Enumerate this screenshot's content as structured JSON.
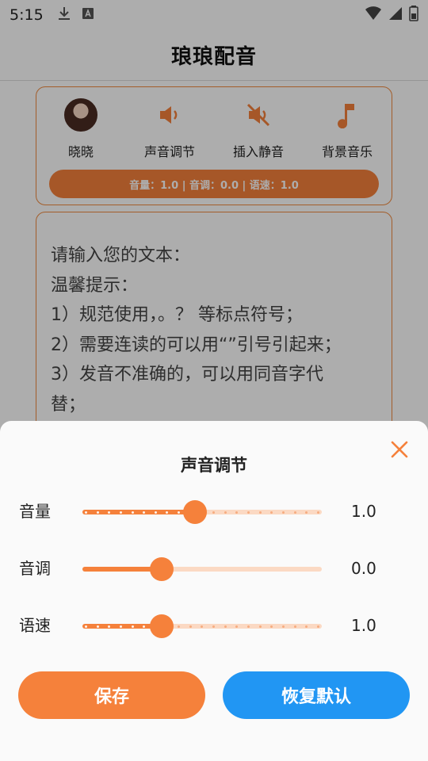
{
  "status_bar": {
    "time": "5:15"
  },
  "app": {
    "title": "琅琅配音"
  },
  "toolbar": {
    "items": [
      {
        "label": "晓晓",
        "icon": "avatar"
      },
      {
        "label": "声音调节",
        "icon": "volume-icon"
      },
      {
        "label": "插入静音",
        "icon": "mute-icon"
      },
      {
        "label": "背景音乐",
        "icon": "music-note-icon"
      }
    ],
    "params_text": "音量：1.0 | 音调：0.0 | 语速：1.0"
  },
  "editor": {
    "lines": [
      "请输入您的文本：",
      "温馨提示：",
      "1）规范使用，。？ 等标点符号；",
      "2）需要连读的可以用“”引号引起来；",
      "3）发音不准确的，可以用同音字代",
      "替；"
    ]
  },
  "sheet": {
    "title": "声音调节",
    "sliders": [
      {
        "label": "音量",
        "value": "1.0",
        "fraction": 0.47,
        "dotted_full": true
      },
      {
        "label": "音调",
        "value": "0.0",
        "fraction": 0.33,
        "dotted_full": false
      },
      {
        "label": "语速",
        "value": "1.0",
        "fraction": 0.33,
        "dotted_full": true
      }
    ],
    "save_label": "保存",
    "reset_label": "恢复默认"
  },
  "colors": {
    "accent": "#f5813b",
    "reset": "#2196f3",
    "track": "#fbd9c3"
  }
}
